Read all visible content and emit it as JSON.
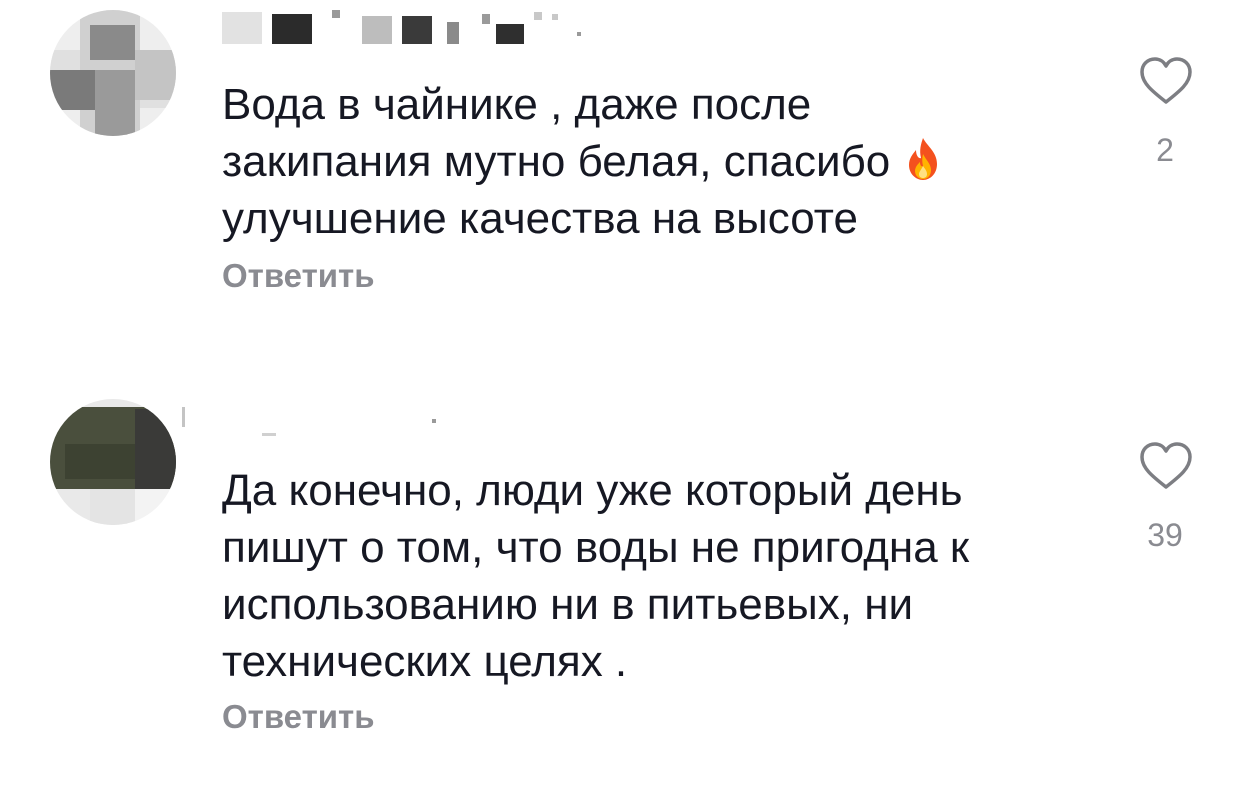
{
  "comments": [
    {
      "text_before_emoji": "Вода в чайнике , даже после\nзакипания мутно белая, спасибо ",
      "emoji": "fire-icon",
      "text_after_emoji": "\nулучшение качества на высоте",
      "reply_label": "Ответить",
      "likes": "2"
    },
    {
      "text": "Да конечно, люди уже который день\nпишут о том, что воды не пригодна к\nиспользованию ни в питьевых, ни\nтехнических целях .",
      "reply_label": "Ответить",
      "likes": "39"
    }
  ],
  "colors": {
    "text": "#161823",
    "secondary": "#8a8b91",
    "background": "#ffffff"
  }
}
